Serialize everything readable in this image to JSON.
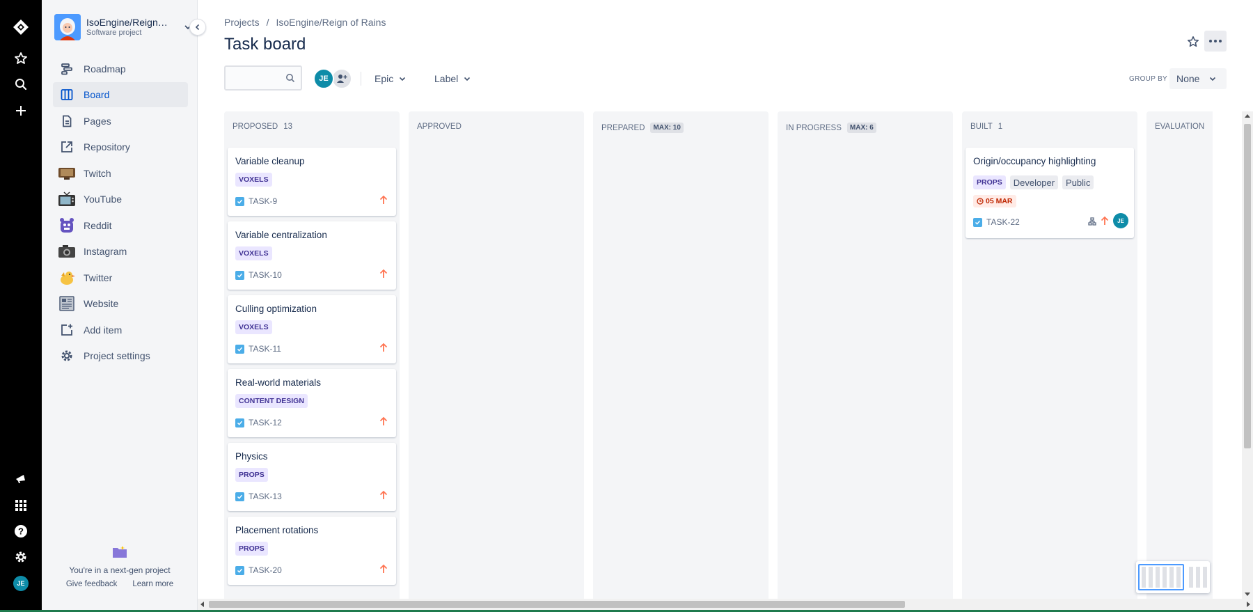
{
  "global_nav": {
    "avatar_initials": "JE"
  },
  "project": {
    "name": "IsoEngine/Reign of Rains",
    "type": "Software project"
  },
  "sidebar": {
    "items": [
      {
        "label": "Roadmap",
        "icon": "roadmap-icon"
      },
      {
        "label": "Board",
        "icon": "board-icon",
        "active": true
      },
      {
        "label": "Pages",
        "icon": "pages-icon"
      },
      {
        "label": "Repository",
        "icon": "repository-icon"
      },
      {
        "label": "Twitch",
        "icon": "twitch-icon"
      },
      {
        "label": "YouTube",
        "icon": "youtube-icon"
      },
      {
        "label": "Reddit",
        "icon": "reddit-icon"
      },
      {
        "label": "Instagram",
        "icon": "instagram-icon"
      },
      {
        "label": "Twitter",
        "icon": "twitter-icon"
      },
      {
        "label": "Website",
        "icon": "website-icon"
      },
      {
        "label": "Add item",
        "icon": "add-item-icon"
      },
      {
        "label": "Project settings",
        "icon": "gear-icon"
      }
    ],
    "footer": {
      "text": "You're in a next-gen project",
      "feedback": "Give feedback",
      "learn_more": "Learn more"
    }
  },
  "header": {
    "breadcrumbs": [
      "Projects",
      "/",
      "IsoEngine/Reign of Rains"
    ],
    "title": "Task board"
  },
  "filters": {
    "search_placeholder": "",
    "assignee_initials": "JE",
    "epic_label": "Epic",
    "label_label": "Label",
    "group_by_label": "GROUP BY",
    "group_by_value": "None"
  },
  "columns": [
    {
      "name": "PROPOSED",
      "count": "13",
      "max": ""
    },
    {
      "name": "APPROVED",
      "count": "",
      "max": ""
    },
    {
      "name": "PREPARED",
      "count": "",
      "max": "MAX: 10"
    },
    {
      "name": "IN PROGRESS",
      "count": "",
      "max": "MAX: 6"
    },
    {
      "name": "BUILT",
      "count": "1",
      "max": ""
    },
    {
      "name": "EVALUATION",
      "count": "",
      "max": ""
    }
  ],
  "proposed_cards": [
    {
      "title": "Variable cleanup",
      "tag": "VOXELS",
      "key": "TASK-9"
    },
    {
      "title": "Variable centralization",
      "tag": "VOXELS",
      "key": "TASK-10"
    },
    {
      "title": "Culling optimization",
      "tag": "VOXELS",
      "key": "TASK-11"
    },
    {
      "title": "Real-world materials",
      "tag": "CONTENT DESIGN",
      "key": "TASK-12"
    },
    {
      "title": "Physics",
      "tag": "PROPS",
      "key": "TASK-13"
    },
    {
      "title": "Placement rotations",
      "tag": "PROPS",
      "key": "TASK-20"
    }
  ],
  "built_card": {
    "title": "Origin/occupancy highlighting",
    "tags": [
      "PROPS",
      "Developer",
      "Public"
    ],
    "due": "05 MAR",
    "key": "TASK-22",
    "assignee": "JE"
  },
  "colors": {
    "accent": "#0052cc",
    "tag_bg": "#eae6ff",
    "tag_text": "#403294",
    "priority": "#ff7452",
    "due_bg": "#ffebe6",
    "due_text": "#bf2600",
    "avatar": "#0e8ca8"
  }
}
